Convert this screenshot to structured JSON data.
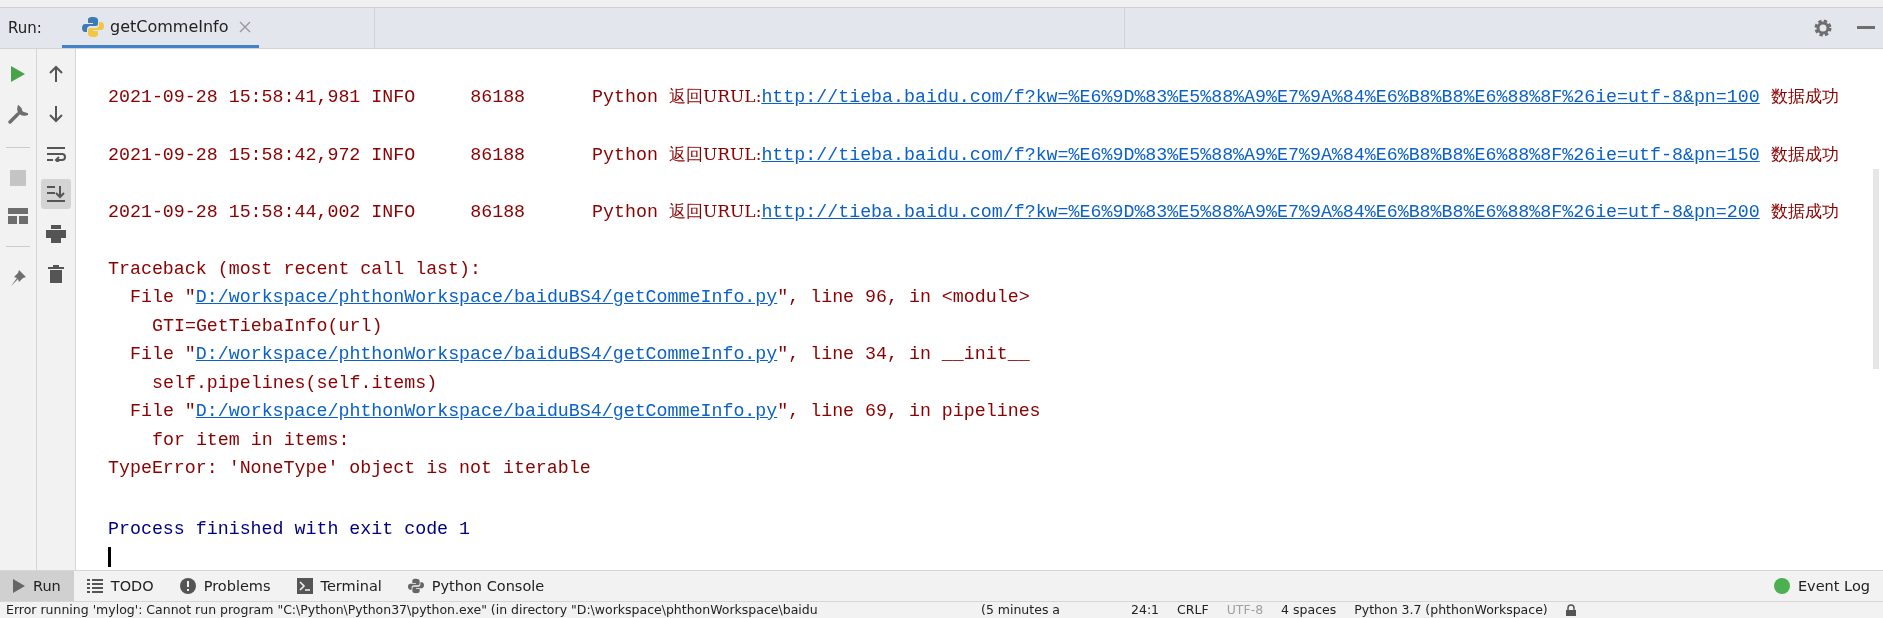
{
  "run_bar": {
    "label": "Run:",
    "tabs": [
      {
        "label": "getCommeInfo",
        "selected": true
      }
    ]
  },
  "left_toolbar": [
    {
      "kind": "run"
    },
    {
      "kind": "wrench"
    },
    {
      "kind": "separator"
    },
    {
      "kind": "stop"
    },
    {
      "kind": "layout"
    },
    {
      "kind": "separator"
    },
    {
      "kind": "pin"
    }
  ],
  "console_toolbar": [
    {
      "kind": "up",
      "selected": false
    },
    {
      "kind": "down",
      "selected": false
    },
    {
      "kind": "wrap",
      "selected": false
    },
    {
      "kind": "scroll-end",
      "selected": true
    },
    {
      "kind": "print",
      "selected": false
    },
    {
      "kind": "trash",
      "selected": false
    }
  ],
  "log_lines": [
    {
      "time": "2021-09-28 15:58:41,981",
      "level": "INFO",
      "pid": "86188",
      "logger": "Python",
      "message": "返回URUL:",
      "url": "http://tieba.baidu.com/f?kw=%E6%9D%83%E5%88%A9%E7%9A%84%E6%B8%B8%E6%88%8F%26ie=utf-8&pn=100",
      "result": "数据成功"
    },
    {
      "time": "2021-09-28 15:58:42,972",
      "level": "INFO",
      "pid": "86188",
      "logger": "Python",
      "message": "返回URUL:",
      "url": "http://tieba.baidu.com/f?kw=%E6%9D%83%E5%88%A9%E7%9A%84%E6%B8%B8%E6%88%8F%26ie=utf-8&pn=150",
      "result": "数据成功"
    },
    {
      "time": "2021-09-28 15:58:44,002",
      "level": "INFO",
      "pid": "86188",
      "logger": "Python",
      "message": "返回URUL:",
      "url": "http://tieba.baidu.com/f?kw=%E6%9D%83%E5%88%A9%E7%9A%84%E6%B8%B8%E6%88%8F%26ie=utf-8&pn=200",
      "result": "数据成功"
    }
  ],
  "traceback": {
    "header": "Traceback (most recent call last):",
    "frames": [
      {
        "open": "File \"",
        "path": "D:/workspace/phthonWorkspace/baiduBS4/getCommeInfo.py",
        "close": "\", line 96, in <module>",
        "code": "GTI=GetTiebaInfo(url)"
      },
      {
        "open": "File \"",
        "path": "D:/workspace/phthonWorkspace/baiduBS4/getCommeInfo.py",
        "close": "\", line 34, in __init__",
        "code": "self.pipelines(self.items)"
      },
      {
        "open": "File \"",
        "path": "D:/workspace/phthonWorkspace/baiduBS4/getCommeInfo.py",
        "close": "\", line 69, in pipelines",
        "code": "for item in items:"
      }
    ],
    "error": "TypeError: 'NoneType' object is not iterable"
  },
  "exit_message": "Process finished with exit code 1",
  "tool_tabs": [
    {
      "kind": "run",
      "label": "Run",
      "selected": true
    },
    {
      "kind": "todo",
      "label": "TODO",
      "selected": false
    },
    {
      "kind": "problems",
      "label": "Problems",
      "selected": false
    },
    {
      "kind": "terminal",
      "label": "Terminal",
      "selected": false
    },
    {
      "kind": "python",
      "label": "Python Console",
      "selected": false
    }
  ],
  "event_log": {
    "label": "Event Log"
  },
  "status_bar": {
    "message": "Error running 'mylog': Cannot run program \"C:\\Python\\Python37\\python.exe\" (in directory \"D:\\workspace\\phthonWorkspace\\baidu",
    "time": "(5 minutes a",
    "items": [
      {
        "text": "24:1",
        "disabled": false
      },
      {
        "text": "CRLF",
        "disabled": false
      },
      {
        "text": "UTF-8",
        "disabled": true
      },
      {
        "text": "4 spaces",
        "disabled": false
      },
      {
        "text": "Python 3.7 (phthonWorkspace)",
        "disabled": false
      }
    ]
  }
}
